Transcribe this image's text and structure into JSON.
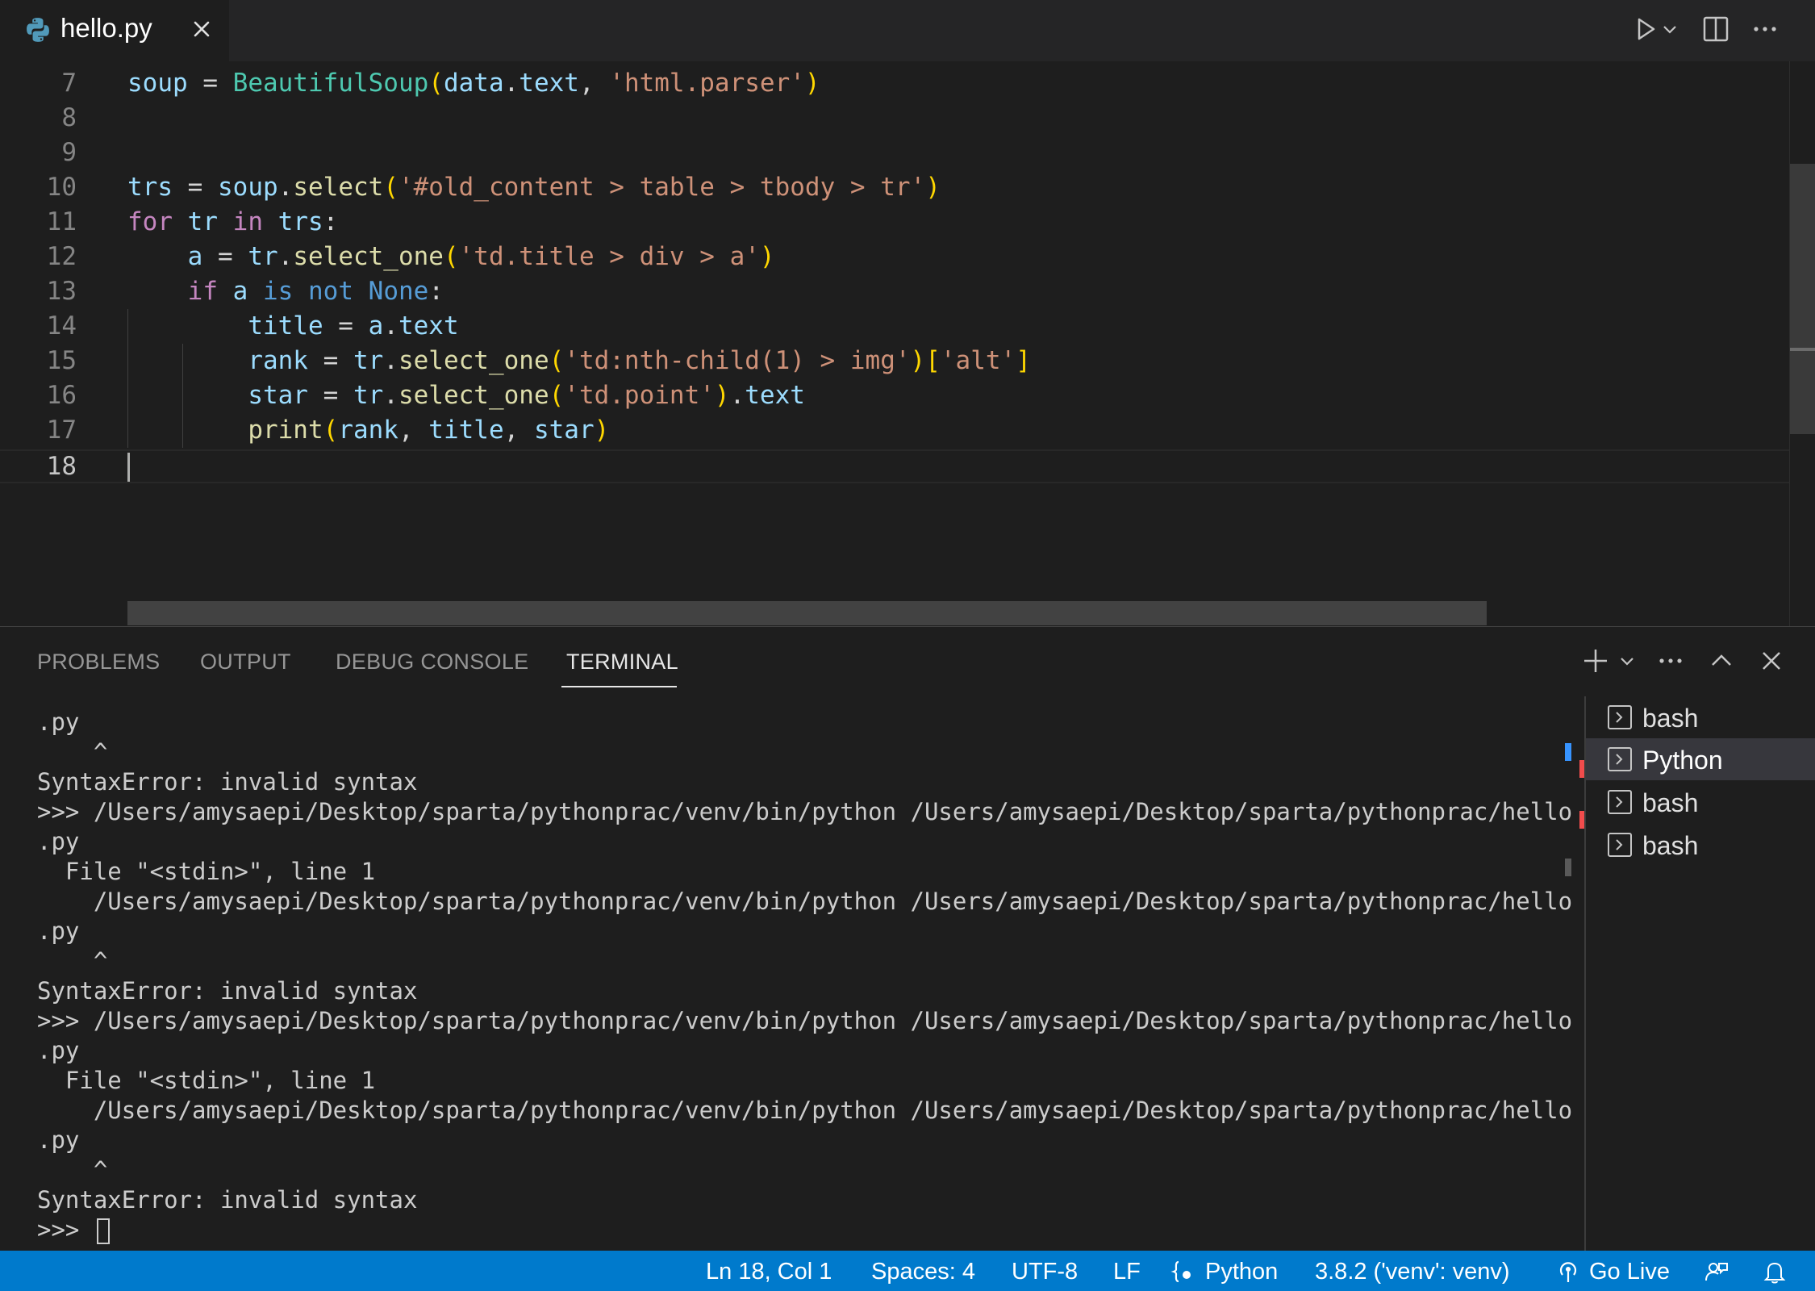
{
  "tab": {
    "filename": "hello.py",
    "icon": "python-icon"
  },
  "editor": {
    "line_numbers": [
      "7",
      "8",
      "9",
      "10",
      "11",
      "12",
      "13",
      "14",
      "15",
      "16",
      "17",
      "18"
    ],
    "active_line": "18"
  },
  "panel": {
    "tabs": [
      "PROBLEMS",
      "OUTPUT",
      "DEBUG CONSOLE",
      "TERMINAL"
    ],
    "active_tab": "TERMINAL",
    "terminal_lines": [
      ".py",
      "    ^",
      "SyntaxError: invalid syntax",
      ">>> /Users/amysaepi/Desktop/sparta/pythonprac/venv/bin/python /Users/amysaepi/Desktop/sparta/pythonprac/hello",
      ".py",
      "  File \"<stdin>\", line 1",
      "    /Users/amysaepi/Desktop/sparta/pythonprac/venv/bin/python /Users/amysaepi/Desktop/sparta/pythonprac/hello",
      ".py",
      "    ^",
      "SyntaxError: invalid syntax",
      ">>> /Users/amysaepi/Desktop/sparta/pythonprac/venv/bin/python /Users/amysaepi/Desktop/sparta/pythonprac/hello",
      ".py",
      "  File \"<stdin>\", line 1",
      "    /Users/amysaepi/Desktop/sparta/pythonprac/venv/bin/python /Users/amysaepi/Desktop/sparta/pythonprac/hello",
      ".py",
      "    ^",
      "SyntaxError: invalid syntax",
      ">>> "
    ],
    "terminals": [
      {
        "label": "bash",
        "selected": false
      },
      {
        "label": "Python",
        "selected": true
      },
      {
        "label": "bash",
        "selected": false
      },
      {
        "label": "bash",
        "selected": false
      }
    ]
  },
  "status": {
    "position": "Ln 18, Col 1",
    "spaces": "Spaces: 4",
    "encoding": "UTF-8",
    "eol": "LF",
    "language": "Python",
    "interpreter": "3.8.2 ('venv': venv)",
    "live": "Go Live"
  },
  "colors": {
    "accent": "#007acc",
    "keyword": "#c586c0",
    "string": "#ce9178",
    "variable": "#9cdcfe",
    "function": "#dcdcaa",
    "class": "#4ec9b0",
    "error_mark": "#f14c4c",
    "info_mark": "#3794ff"
  }
}
